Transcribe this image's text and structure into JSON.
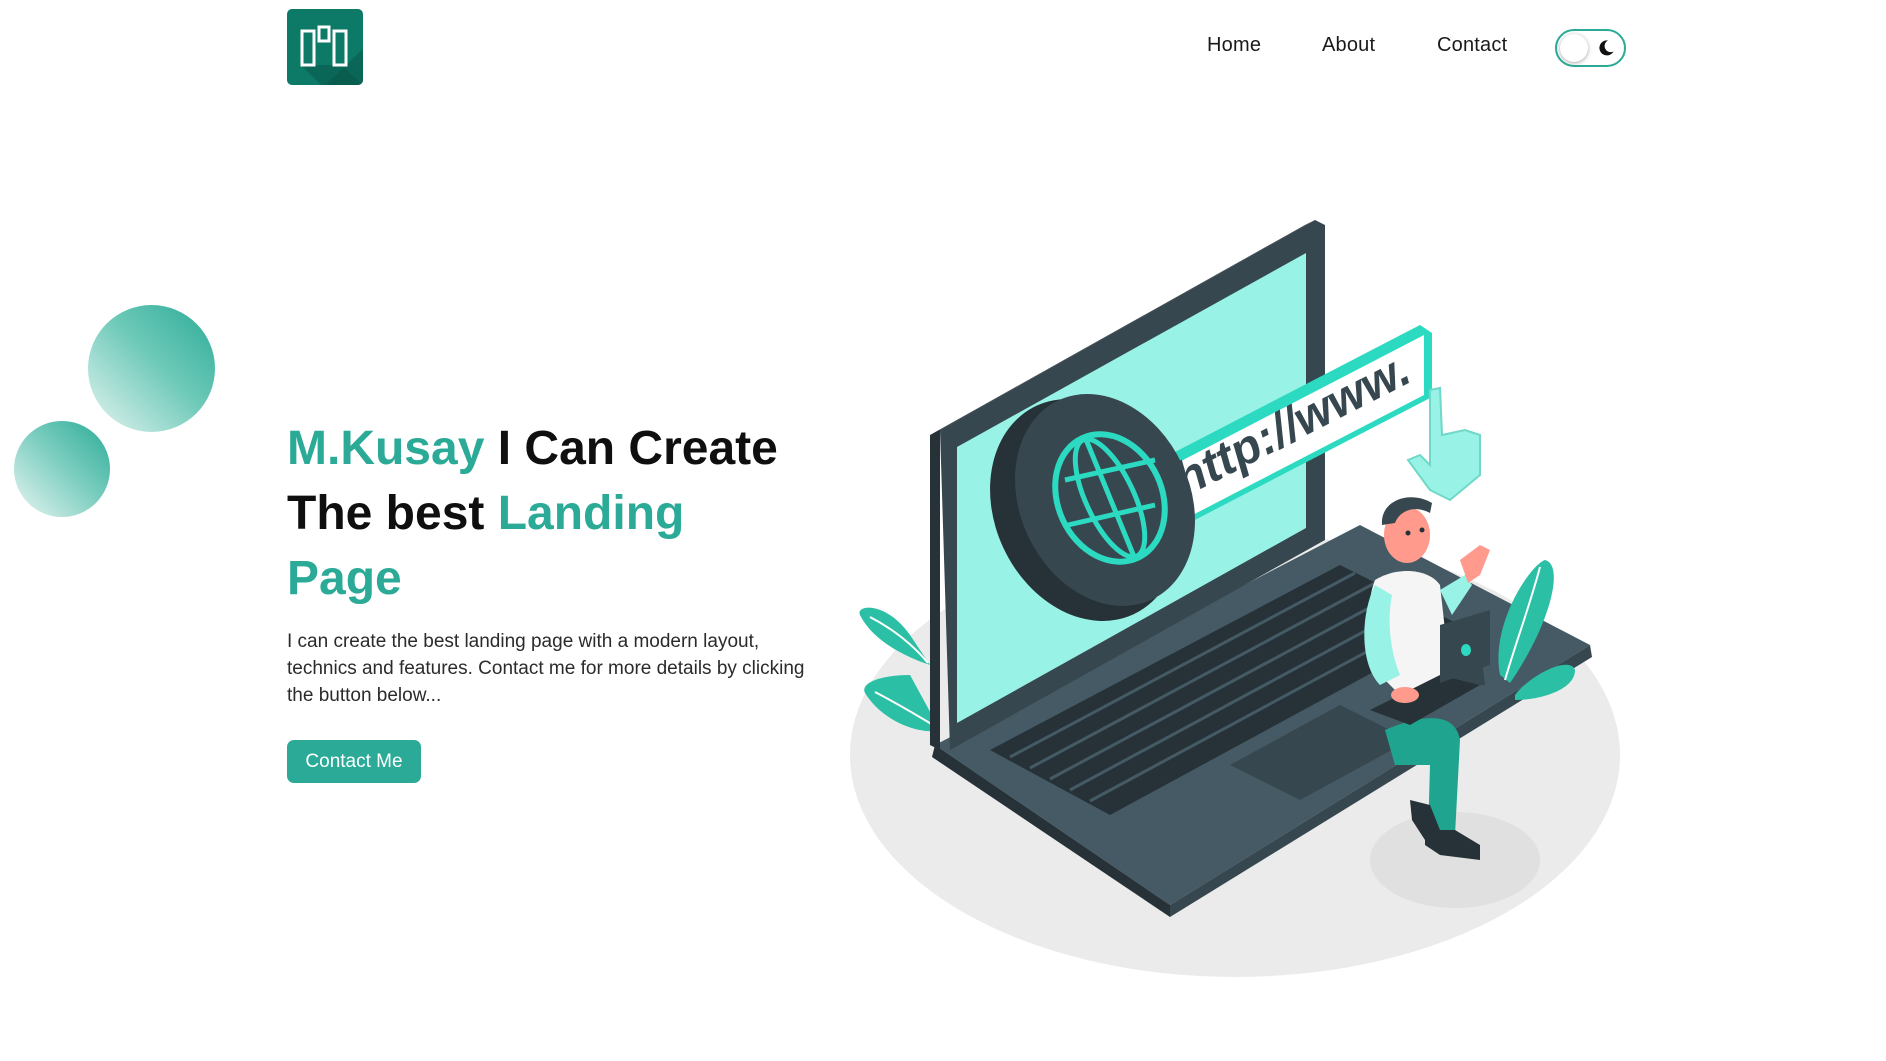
{
  "header": {
    "logo_icon": "columns-logo-icon",
    "nav": [
      {
        "label": "Home"
      },
      {
        "label": "About"
      },
      {
        "label": "Contact"
      }
    ],
    "theme_toggle": {
      "icon": "moon-icon",
      "dark_mode": false
    }
  },
  "hero": {
    "title": {
      "name": "M.Kusay",
      "line1_rest": " I Can Create",
      "line2_start": "The best ",
      "accent_word": "Landing",
      "line3": "Page"
    },
    "description": "I can create the best landing page with a modern layout, technics and features. Contact me for more details by clicking the button below...",
    "cta_label": "Contact Me",
    "illustration": {
      "url_text": "http://www."
    }
  },
  "colors": {
    "accent": "#2baa97",
    "logo_bg": "#0c7a66",
    "dark": "#37474f",
    "screen": "#98f2e6"
  }
}
